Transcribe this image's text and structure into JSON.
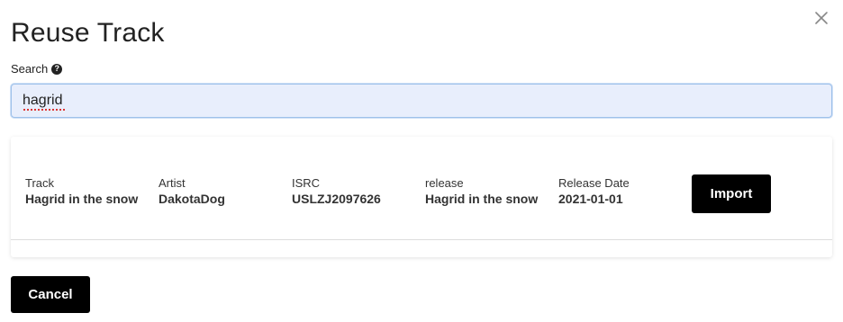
{
  "dialog": {
    "title": "Reuse Track",
    "close_icon": "close-icon"
  },
  "search": {
    "label": "Search",
    "help_icon": "question-circle-icon",
    "help_glyph": "?",
    "value": "hagrid"
  },
  "results": [
    {
      "track_label": "Track",
      "track": "Hagrid in the snow",
      "artist_label": "Artist",
      "artist": "DakotaDog",
      "isrc_label": "ISRC",
      "isrc": "USLZJ2097626",
      "release_label": "release",
      "release": "Hagrid in the snow",
      "release_date_label": "Release Date",
      "release_date": "2021-01-01",
      "import_label": "Import"
    }
  ],
  "footer": {
    "cancel_label": "Cancel"
  }
}
